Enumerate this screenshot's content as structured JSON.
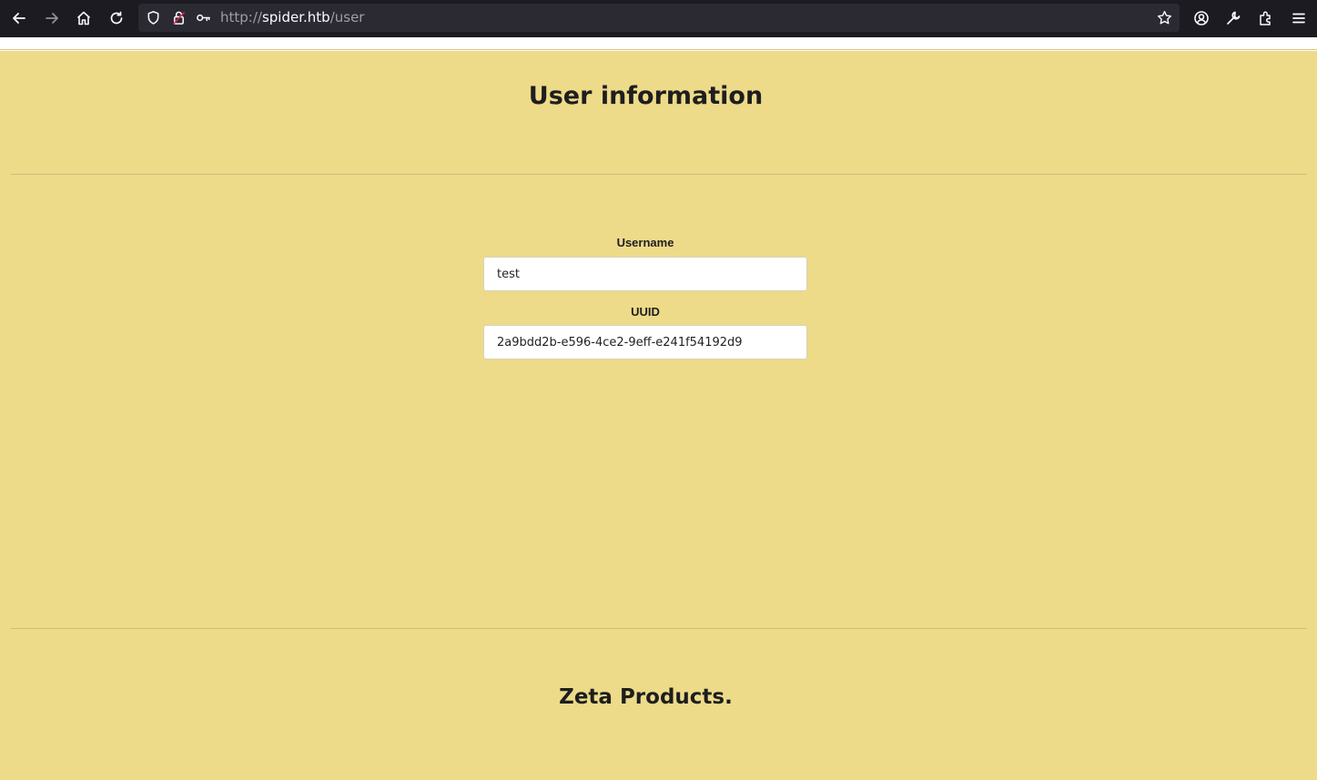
{
  "browser": {
    "url_scheme": "http://",
    "url_host": "spider.htb",
    "url_path": "/user",
    "icons": [
      "back-icon",
      "forward-icon",
      "home-icon",
      "reload-icon",
      "shield-icon",
      "lock-icon",
      "key-icon",
      "star-icon",
      "account-icon",
      "wrench-icon",
      "extensions-icon",
      "menu-icon"
    ]
  },
  "page": {
    "title": "User information",
    "username_label": "Username",
    "username_value": "test",
    "uuid_label": "UUID",
    "uuid_value": "2a9bdd2b-e596-4ce2-9eff-e241f54192d9",
    "footer_brand": "Zeta Products.",
    "background_color": "#eddb8a"
  }
}
